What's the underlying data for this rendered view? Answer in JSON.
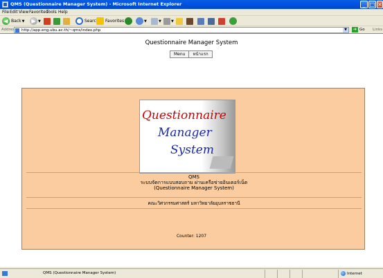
{
  "window": {
    "title": "QMS (Questionnaire Manager System) - Microsoft Internet Explorer"
  },
  "menu": [
    "File",
    "Edit",
    "View",
    "Favorites",
    "Tools",
    "Help"
  ],
  "toolbar": {
    "back": "Back",
    "search": "Search",
    "favorites": "Favorites"
  },
  "address": {
    "label": "Address",
    "url": "http://app.eng.ubu.ac.th/~qms/index.php",
    "go": "Go",
    "links": "Links"
  },
  "page": {
    "title": "Questionnaire Manager System",
    "nav": [
      "Menu",
      "หน้าแรก"
    ],
    "logo": {
      "line1": "Questionnaire",
      "line2": "Manager",
      "line3": "System"
    },
    "info": {
      "abbr": "QMS",
      "thai_name": "ระบบจัดการแบบสอบถาม ผ่านเครือข่ายอินเตอร์เน็ต",
      "english_name": "(Questionnaire Manager System)"
    },
    "faculty": "คณะวิศวกรรมศาสตร์ มหาวิทยาลัยอุบลราชธานี",
    "counter": "Counter: 1207"
  },
  "status": {
    "text": "QMS (Questionnaire Manager System)",
    "zone": "Internet"
  }
}
